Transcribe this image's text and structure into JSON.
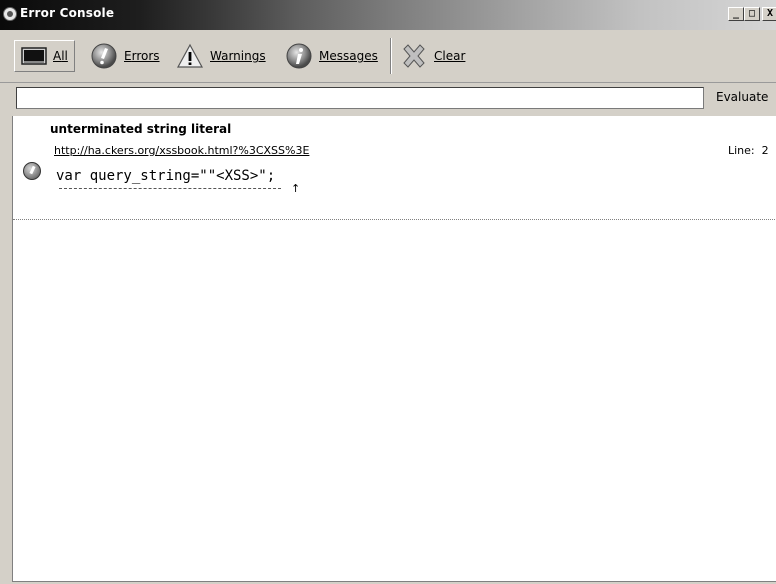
{
  "window": {
    "title": "Error Console",
    "controls": {
      "minimize": "_",
      "maximize": "□",
      "close": "X"
    }
  },
  "toolbar": {
    "all_label": "All",
    "errors_label": "Errors",
    "warnings_label": "Warnings",
    "messages_label": "Messages",
    "clear_label": "Clear",
    "selected": "All"
  },
  "eval": {
    "value": "",
    "placeholder": "",
    "button_label": "Evaluate"
  },
  "entries": [
    {
      "type": "error",
      "message": "unterminated string literal",
      "source": "http://ha.ckers.org/xssbook.html?%3CXSS%3E",
      "line_label": "Line:  2",
      "code": "var query_string=\"\"<XSS>\";",
      "caret": "↑"
    }
  ],
  "colors": {
    "chrome": "#d4d0c8",
    "titlebar_dark": "#0a0a0a",
    "titlebar_light": "#d6d6d6",
    "content_bg": "#ffffff"
  }
}
